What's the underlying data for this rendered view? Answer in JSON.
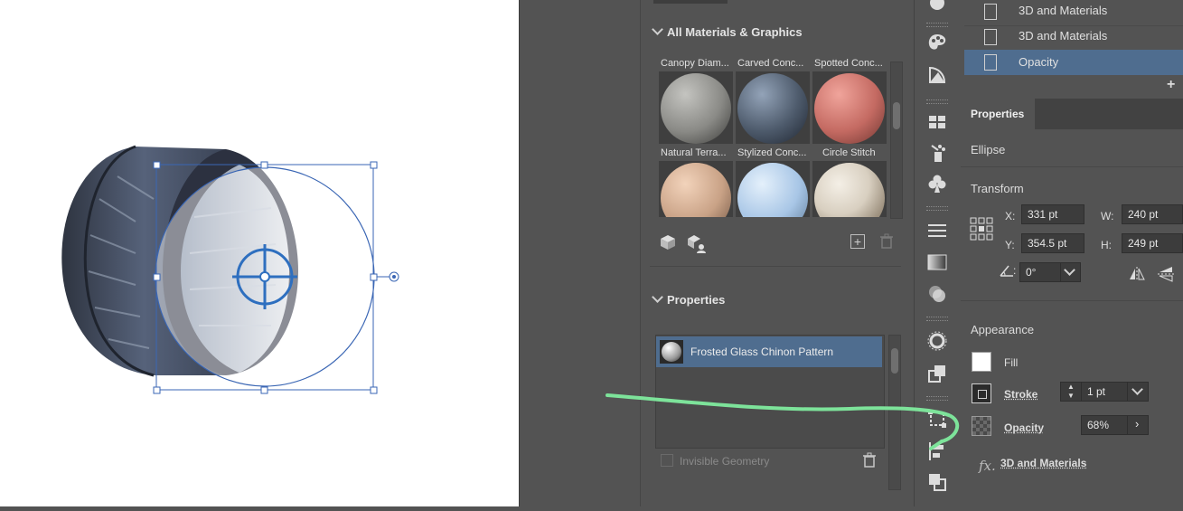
{
  "materials_panel": {
    "section_all": "All Materials & Graphics",
    "top_labels": [
      "Canopy Diam...",
      "Carved Conc...",
      "Spotted Conc..."
    ],
    "tiles": [
      {
        "label": "Natural Terra...",
        "color": "#8a8a86"
      },
      {
        "label": "Stylized Conc...",
        "color": "#4d5a6b"
      },
      {
        "label": "Circle Stitch",
        "color": "#c46a62"
      },
      {
        "label": "",
        "color": "#c9a286"
      },
      {
        "label": "",
        "color": "#a8c6e6"
      },
      {
        "label": "",
        "color": "#d8cfc0"
      }
    ],
    "section_props": "Properties",
    "selected_material": "Frosted Glass Chinon Pattern",
    "invisible_geometry": "Invisible Geometry"
  },
  "layers": [
    "3D and Materials",
    "3D and Materials",
    "Opacity"
  ],
  "properties": {
    "tab": "Properties",
    "object": "Ellipse",
    "transform_title": "Transform",
    "x_label": "X:",
    "x_value": "331 pt",
    "y_label": "Y:",
    "y_value": "354.5 pt",
    "w_label": "W:",
    "w_value": "240 pt",
    "h_label": "H:",
    "h_value": "249 pt",
    "angle_value": "0°",
    "appearance_title": "Appearance",
    "fill_label": "Fill",
    "stroke_label": "Stroke",
    "stroke_value": "1 pt",
    "opacity_label": "Opacity",
    "opacity_value": "68%",
    "fx_label": "3D and Materials"
  },
  "colors": {
    "accent": "#3a66b4",
    "annotation": "#7de39a",
    "selection": "#4f6d8f"
  }
}
